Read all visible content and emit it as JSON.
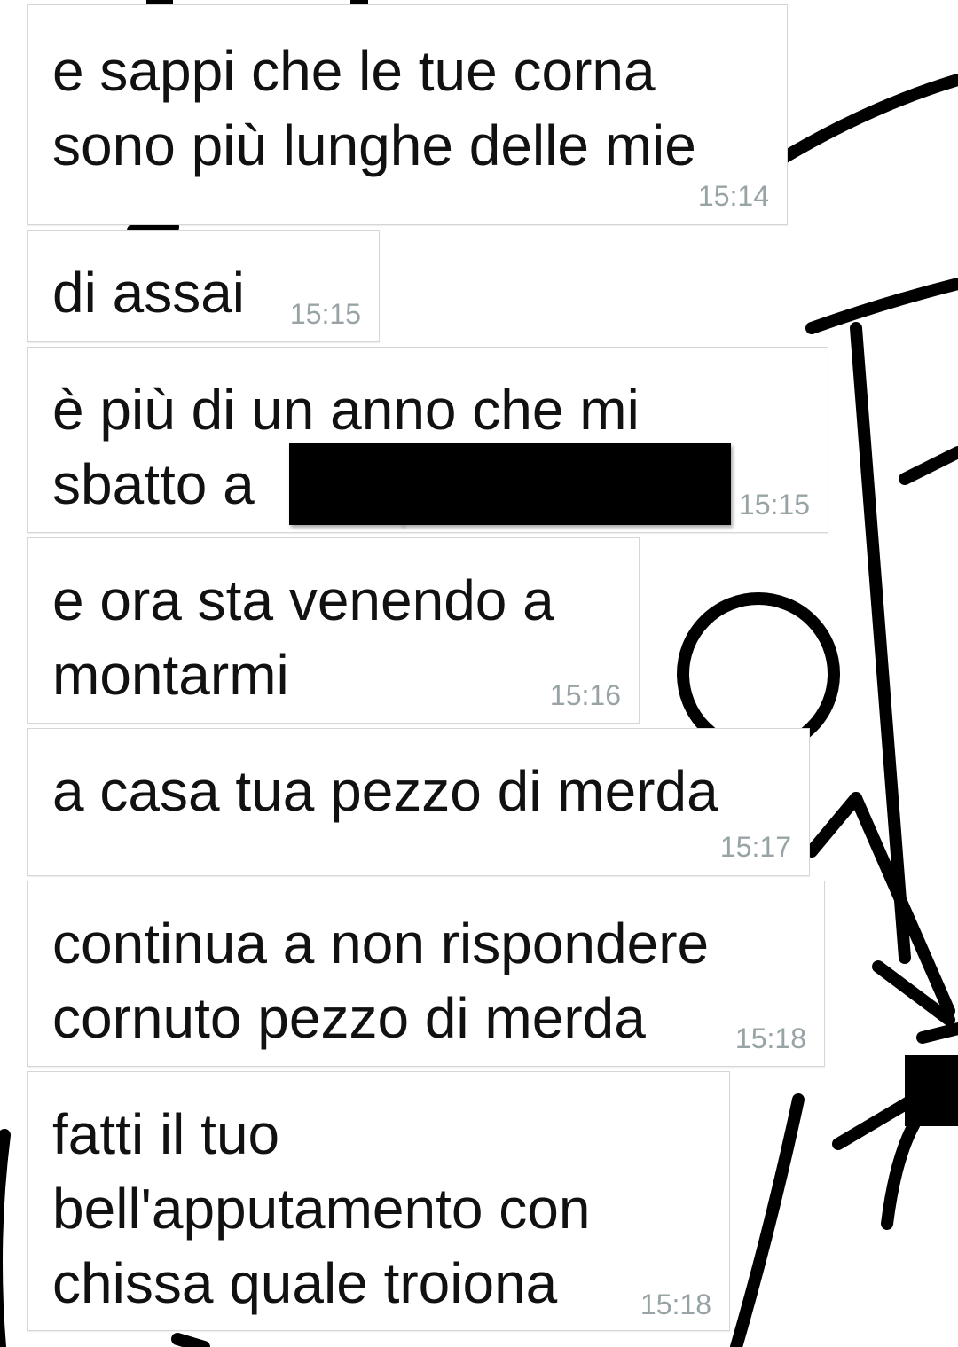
{
  "messages": [
    {
      "text": "e sappi che le tue corna\nsono più lunghe delle mie",
      "time": "15:14"
    },
    {
      "text": "di assai",
      "time": "15:15"
    },
    {
      "text": "è più di un anno che mi\nsbatto a",
      "time": "15:15",
      "redacted": true
    },
    {
      "text": "e ora sta venendo a\nmontarmi",
      "time": "15:16"
    },
    {
      "text": "a casa tua pezzo di merda",
      "time": "15:17"
    },
    {
      "text": "continua a non rispondere\ncornuto pezzo di merda",
      "time": "15:18"
    },
    {
      "text": "fatti il tuo\nbell'apputamento con\nchissa quale troiona",
      "time": "15:18"
    }
  ],
  "colors": {
    "bubble_bg": "#ffffff",
    "bubble_border": "#d6d6d6",
    "text": "#111111",
    "timestamp": "#98a3a6",
    "background_drawing": "#000000"
  },
  "background": {
    "icon": "wallpaper-stick-figure-doodle"
  }
}
